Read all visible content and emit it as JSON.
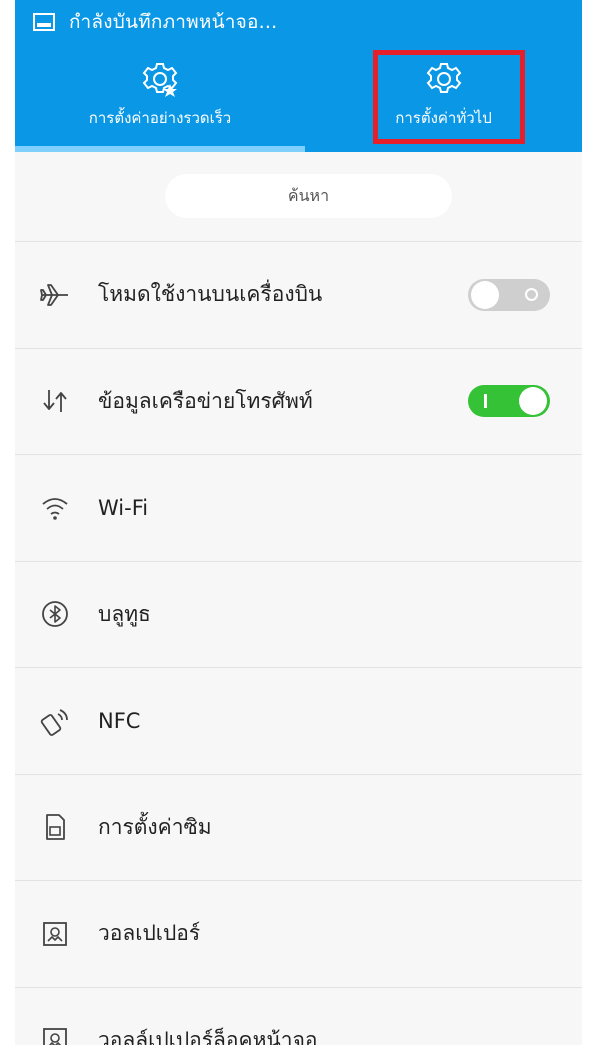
{
  "status_bar": {
    "text": "กำลังบันทึกภาพหน้าจอ..."
  },
  "tabs": [
    {
      "label": "การตั้งค่าอย่างรวดเร็ว",
      "icon": "gear-star-icon",
      "active": true
    },
    {
      "label": "การตั้งค่าทั่วไป",
      "icon": "gear-icon",
      "active": false
    }
  ],
  "search": {
    "label": "ค้นหา"
  },
  "items": [
    {
      "label": "โหมดใช้งานบนเครื่องบิน",
      "icon": "airplane-icon",
      "toggle": "off"
    },
    {
      "label": "ข้อมูลเครือข่ายโทรศัพท์",
      "icon": "mobile-data-icon",
      "toggle": "on"
    },
    {
      "label": "Wi-Fi",
      "icon": "wifi-icon"
    },
    {
      "label": "บลูทูธ",
      "icon": "bluetooth-icon"
    },
    {
      "label": "NFC",
      "icon": "nfc-icon"
    },
    {
      "label": "การตั้งค่าซิม",
      "icon": "sim-card-icon"
    },
    {
      "label": "วอลเปเปอร์",
      "icon": "wallpaper-icon"
    },
    {
      "label": "วอลล์เปเปอร์ล็อคหน้าจอ",
      "icon": "lock-wallpaper-icon"
    }
  ],
  "colors": {
    "header": "#0a97e6",
    "highlight": "#e5202a",
    "toggle_on": "#35c236",
    "toggle_off": "#cfcfcf"
  }
}
